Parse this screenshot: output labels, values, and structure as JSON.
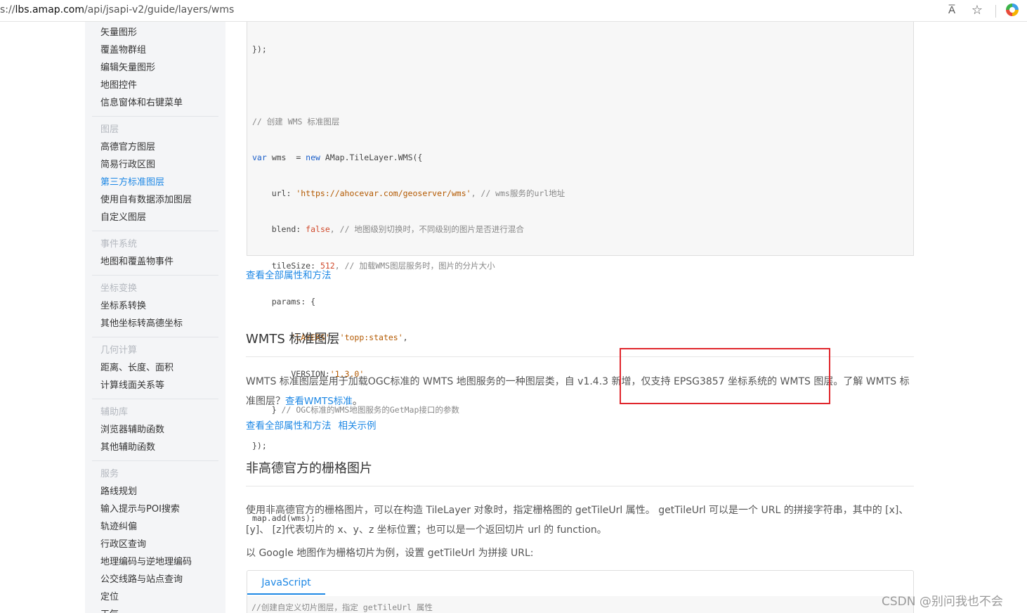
{
  "browser": {
    "url_prefix": "s://",
    "url_host": "lbs.amap.com",
    "url_path": "/api/jsapi-v2/guide/layers/wms",
    "read_aloud_label": "A̅",
    "icons": [
      "read-aloud-icon",
      "add-favorite-icon",
      "extension-icon"
    ]
  },
  "sidebar": {
    "groups": [
      {
        "title": "",
        "items": [
          "矢量图形",
          "覆盖物群组",
          "编辑矢量图形",
          "地图控件",
          "信息窗体和右键菜单"
        ]
      },
      {
        "title": "图层",
        "items": [
          "高德官方图层",
          "简易行政区图",
          "第三方标准图层",
          "使用自有数据添加图层",
          "自定义图层"
        ],
        "active": "第三方标准图层"
      },
      {
        "title": "事件系统",
        "items": [
          "地图和覆盖物事件"
        ]
      },
      {
        "title": "坐标变换",
        "items": [
          "坐标系转换",
          "其他坐标转高德坐标"
        ]
      },
      {
        "title": "几何计算",
        "items": [
          "距离、长度、面积",
          "计算线面关系等"
        ]
      },
      {
        "title": "辅助库",
        "items": [
          "浏览器辅助函数",
          "其他辅助函数"
        ]
      },
      {
        "title": "服务",
        "items": [
          "路线规划",
          "输入提示与POI搜索",
          "轨迹纠偏",
          "行政区查询",
          "地理编码与逆地理编码",
          "公交线路与站点查询",
          "定位",
          "天气"
        ]
      }
    ]
  },
  "code": {
    "l1": "});",
    "l2_comment": "// 创建 WMS 标准图层",
    "l3_var": "var",
    "l3_mid": " wms  = ",
    "l3_new": "new",
    "l3_rest": " AMap.TileLayer.WMS({",
    "url_key": "    url: ",
    "url_val": "'https://ahocevar.com/geoserver/wms'",
    "url_comment": ", // wms服务的url地址",
    "blend_key": "    blend: ",
    "blend_val": "false",
    "blend_comment": ", // 地图级别切换时，不同级别的图片是否进行混合",
    "tile_key": "    tileSize: ",
    "tile_val": "512",
    "tile_comment": ", // 加载WMS图层服务时，图片的分片大小",
    "params_open": "    params: {",
    "layers_key": "        ",
    "layers_k": "'LAYERS'",
    "layers_sep": ": ",
    "layers_v": "'topp:states'",
    "layers_end": ",",
    "ver_key": "        VERSION:",
    "ver_val": "'1.3.0'",
    "params_close": "    } ",
    "params_comment": "// OGC标准的WMS地图服务的GetMap接口的参数",
    "close": "});",
    "blank": "",
    "add": "map.add(wms);"
  },
  "links": {
    "view_all": "查看全部属性和方法",
    "related": "相关示例",
    "wmts_std": "查看WMTS标准"
  },
  "wmts": {
    "heading": "WMTS 标准图层",
    "para_a": "WMTS 标准图层是用于加载OGC标准的 WMTS 地图服务的一种图层类，自 v1.4.3 新增，仅支持 EPSG3857 坐标系统的 WMTS 图层。了解 WMTS 标准图层？",
    "para_end": "。"
  },
  "raster": {
    "heading": "非高德官方的栅格图片",
    "para1": "使用非高德官方的栅格图片，可以在构造 TileLayer 对象时，指定栅格图的 getTileUrl 属性。 getTileUrl 可以是一个 URL 的拼接字符串，其中的 [x]、[y]、 [z]代表切片的 x、y、z 坐标位置；也可以是一个返回切片 url 的 function。",
    "para2": "以 Google 地图作为栅格切片为例，设置 getTileUrl 为拼接 URL:",
    "tab": "JavaScript",
    "code_line": "//创建自定义切片图层，指定 getTileUrl 属性"
  },
  "watermark": "CSDN @别问我也不会",
  "colors": {
    "link": "#1e88e5",
    "highlight_box": "#e0262c",
    "sidebar_bg": "#f4f5f7"
  }
}
